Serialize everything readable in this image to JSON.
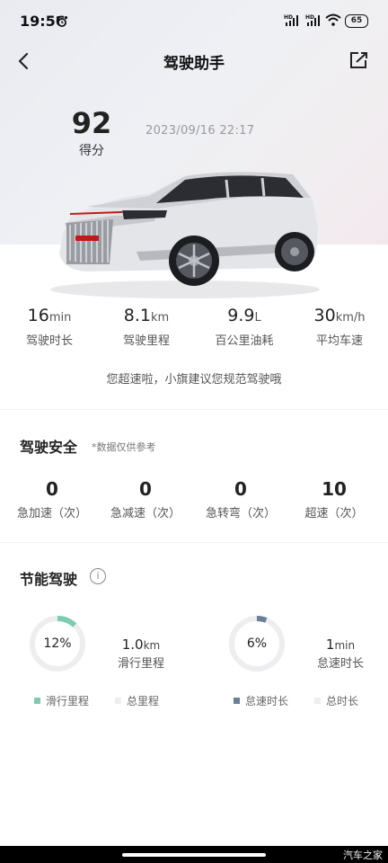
{
  "status_bar": {
    "time": "19:56",
    "battery": "65",
    "signal_tag": "HD"
  },
  "header": {
    "title": "驾驶助手"
  },
  "score": {
    "value": "92",
    "label": "得分"
  },
  "trip_datetime": "2023/09/16  22:17",
  "car_badge": "红旗",
  "stats": [
    {
      "value": "16",
      "unit": "min",
      "label": "驾驶时长"
    },
    {
      "value": "8.1",
      "unit": "km",
      "label": "驾驶里程"
    },
    {
      "value": "9.9",
      "unit": "L",
      "label": "百公里油耗"
    },
    {
      "value": "30",
      "unit": "km/h",
      "label": "平均车速"
    }
  ],
  "notice": "您超速啦，小旗建议您规范驾驶哦",
  "safety": {
    "title": "驾驶安全",
    "note": "*数据仅供参考",
    "items": [
      {
        "value": "0",
        "label": "急加速（次）"
      },
      {
        "value": "0",
        "label": "急减速（次）"
      },
      {
        "value": "0",
        "label": "急转弯（次）"
      },
      {
        "value": "10",
        "label": "超速（次）"
      }
    ]
  },
  "eco": {
    "title": "节能驾驶",
    "info_icon": "i",
    "coasting": {
      "percent_label": "12%",
      "fraction": 0.12,
      "value": "1.0",
      "unit": "km",
      "label": "滑行里程",
      "color": "#7ecbb0",
      "legend_primary": "滑行里程",
      "legend_secondary": "总里程"
    },
    "idle": {
      "percent_label": "6%",
      "fraction": 0.06,
      "value": "1",
      "unit": "min",
      "label": "怠速时长",
      "color": "#6b7f99",
      "legend_primary": "怠速时长",
      "legend_secondary": "总时长"
    }
  },
  "watermark": "汽车之家",
  "colors": {
    "track": "#eeeef0",
    "hero_bg": "#eceef3"
  }
}
